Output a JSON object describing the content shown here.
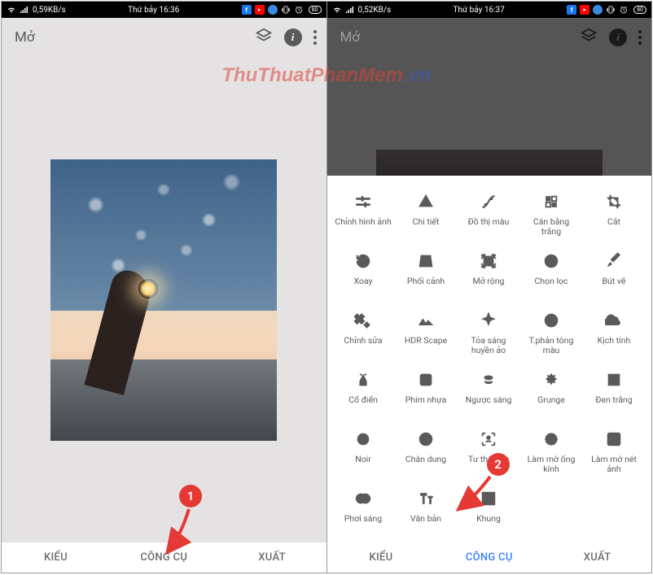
{
  "watermark": {
    "part1": "ThuThuatPhanMem",
    "part2": ".vn"
  },
  "left": {
    "status": {
      "net": "0,59KB/s",
      "time": "Thứ bảy 16:36",
      "battery": "80"
    },
    "appbar": {
      "title": "Mở"
    },
    "tabs": {
      "styles": "KIỂU",
      "tools": "CÔNG CỤ",
      "export": "XUẤT"
    }
  },
  "right": {
    "status": {
      "net": "0,52KB/s",
      "time": "Thứ bảy 16:37",
      "battery": "80"
    },
    "appbar": {
      "title": "Mở"
    },
    "tabs": {
      "styles": "KIỂU",
      "tools": "CÔNG CỤ",
      "export": "XUẤT"
    },
    "tools": [
      [
        {
          "name": "tune",
          "label": "Chỉnh hình ảnh"
        },
        {
          "name": "details",
          "label": "Chi tiết"
        },
        {
          "name": "curves",
          "label": "Đồ thị màu"
        },
        {
          "name": "white-balance",
          "label": "Cân bằng trắng"
        },
        {
          "name": "crop",
          "label": "Cắt"
        }
      ],
      [
        {
          "name": "rotate",
          "label": "Xoay"
        },
        {
          "name": "perspective",
          "label": "Phối cảnh"
        },
        {
          "name": "expand",
          "label": "Mở rộng"
        },
        {
          "name": "selective",
          "label": "Chọn lọc"
        },
        {
          "name": "brush",
          "label": "Bút vẽ"
        }
      ],
      [
        {
          "name": "healing",
          "label": "Chỉnh sửa"
        },
        {
          "name": "hdr",
          "label": "HDR Scape"
        },
        {
          "name": "glamour",
          "label": "Tỏa sáng huyền ảo"
        },
        {
          "name": "tonal",
          "label": "T.phản tông màu"
        },
        {
          "name": "drama",
          "label": "Kịch tính"
        }
      ],
      [
        {
          "name": "vintage",
          "label": "Cổ điển"
        },
        {
          "name": "grainy",
          "label": "Phim nhựa"
        },
        {
          "name": "retrolux",
          "label": "Ngược sáng"
        },
        {
          "name": "grunge",
          "label": "Grunge"
        },
        {
          "name": "bw",
          "label": "Đen trắng"
        }
      ],
      [
        {
          "name": "noir",
          "label": "Noir"
        },
        {
          "name": "portrait",
          "label": "Chân dung"
        },
        {
          "name": "headpose",
          "label": "Tư thế đầu"
        },
        {
          "name": "lensblur",
          "label": "Làm mờ ống kính"
        },
        {
          "name": "vignette",
          "label": "Làm mờ nét ảnh"
        }
      ],
      [
        {
          "name": "double",
          "label": "Phơi sáng"
        },
        {
          "name": "text",
          "label": "Văn bản"
        },
        {
          "name": "frames",
          "label": "Khung"
        }
      ]
    ]
  },
  "annotations": {
    "badge1": "1",
    "badge2": "2"
  }
}
